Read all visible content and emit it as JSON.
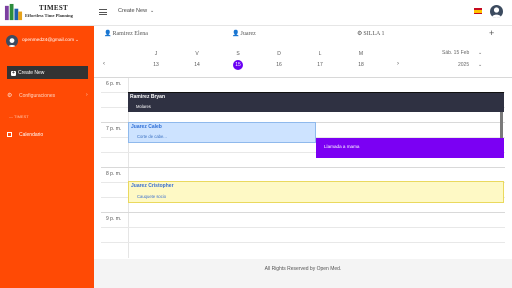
{
  "brand": {
    "title": "TIMEST",
    "subtitle": "Effortless Time Planning"
  },
  "header": {
    "create_new_label": "Create New",
    "language_flag": "es"
  },
  "sidebar": {
    "user_email": "openmed24@gmail.com",
    "create_new_button": "Create New",
    "config_label": "Configuraciones",
    "section_label": "TIMEST",
    "calendar_label": "Calendario",
    "color": "#ff4a05"
  },
  "resources": [
    {
      "name": "Ramirez Elena"
    },
    {
      "name": "Juarez"
    },
    {
      "name": "SILLA 1"
    }
  ],
  "week": {
    "days": [
      {
        "dow": "J",
        "num": "13"
      },
      {
        "dow": "V",
        "num": "14"
      },
      {
        "dow": "S",
        "num": "15",
        "selected": true
      },
      {
        "dow": "D",
        "num": "16"
      },
      {
        "dow": "L",
        "num": "17"
      },
      {
        "dow": "M",
        "num": "18"
      }
    ],
    "selected_date": "Sáb. 15 Feb",
    "selected_year": "2025"
  },
  "time_labels": [
    "6 p. m.",
    "7 p. m.",
    "8 p. m.",
    "9 p. m."
  ],
  "events": [
    {
      "who": "Ramirez Bryan",
      "what": "Molares",
      "color": "#2f3142"
    },
    {
      "who": "Juarez Caleb",
      "what": "Corte de cabe...",
      "color": "#cde3ff"
    },
    {
      "who": "",
      "what": "Llamada a mama",
      "color": "#7b00f3"
    },
    {
      "who": "Juarez Cristopher",
      "what": "Cauquete socio",
      "color": "#fef9c5"
    }
  ],
  "footer": {
    "text": "All Rights Reserved by Open Med."
  },
  "accent_color": "#6a00f4"
}
